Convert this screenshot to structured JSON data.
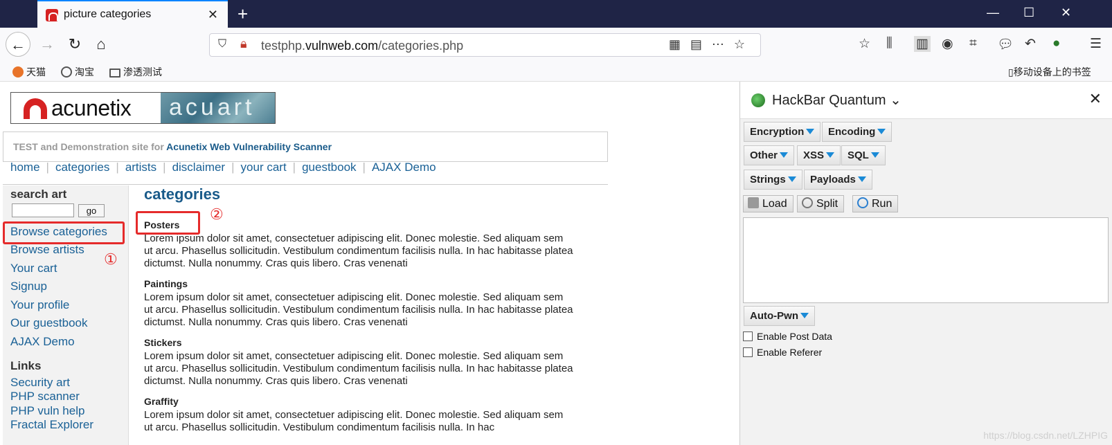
{
  "browser": {
    "tab_title": "picture categories",
    "new_tab": "+",
    "window_controls": [
      "—",
      "☐",
      "✕"
    ],
    "url_prefix": "testphp.",
    "url_domain": "vulnweb.com",
    "url_path": "/categories.php",
    "bookmarks": [
      "天猫",
      "淘宝",
      "渗透测试"
    ],
    "mobile_bookmarks": "移动设备上的书签"
  },
  "page": {
    "logo_brand": "acunetix",
    "logo_art": "acuart",
    "tagline_prefix": "TEST and Demonstration site for ",
    "tagline_link": "Acunetix Web Vulnerability Scanner",
    "nav": [
      "home",
      "categories",
      "artists",
      "disclaimer",
      "your cart",
      "guestbook",
      "AJAX Demo"
    ],
    "search_heading": "search art",
    "go_button": "go",
    "sidebar_links": [
      "Browse categories",
      "Browse artists",
      "Your cart",
      "Signup",
      "Your profile",
      "Our guestbook",
      "AJAX Demo"
    ],
    "links_heading": "Links",
    "external_links": [
      "Security art",
      "PHP scanner",
      "PHP vuln help",
      "Fractal Explorer"
    ],
    "heading": "categories",
    "categories": [
      {
        "name": "Posters",
        "description": "Lorem ipsum dolor sit amet, consectetuer adipiscing elit. Donec molestie. Sed aliquam sem ut arcu. Phasellus sollicitudin. Vestibulum condimentum facilisis nulla. In hac habitasse platea dictumst. Nulla nonummy. Cras quis libero. Cras venenati"
      },
      {
        "name": "Paintings",
        "description": "Lorem ipsum dolor sit amet, consectetuer adipiscing elit. Donec molestie. Sed aliquam sem ut arcu. Phasellus sollicitudin. Vestibulum condimentum facilisis nulla. In hac habitasse platea dictumst. Nulla nonummy. Cras quis libero. Cras venenati"
      },
      {
        "name": "Stickers",
        "description": "Lorem ipsum dolor sit amet, consectetuer adipiscing elit. Donec molestie. Sed aliquam sem ut arcu. Phasellus sollicitudin. Vestibulum condimentum facilisis nulla. In hac habitasse platea dictumst. Nulla nonummy. Cras quis libero. Cras venenati"
      },
      {
        "name": "Graffity",
        "description": "Lorem ipsum dolor sit amet, consectetuer adipiscing elit. Donec molestie. Sed aliquam sem ut arcu. Phasellus sollicitudin. Vestibulum condimentum facilisis nulla. In hac"
      }
    ],
    "annotation_1": "①",
    "annotation_2": "②"
  },
  "hackbar": {
    "title": "HackBar Quantum",
    "menus": [
      "Encryption",
      "Encoding",
      "Other",
      "XSS",
      "SQL",
      "Strings",
      "Payloads"
    ],
    "load": "Load",
    "split": "Split",
    "run": "Run",
    "auto_pwn": "Auto-Pwn",
    "enable_post": "Enable Post Data",
    "enable_referer": "Enable Referer"
  },
  "watermark": "https://blog.csdn.net/LZHPIG",
  "colors": {
    "title_bar": "#1f2446",
    "link": "#1a6196",
    "highlight": "#e52b2b",
    "dropdown_arrow": "#1a8ad6"
  }
}
